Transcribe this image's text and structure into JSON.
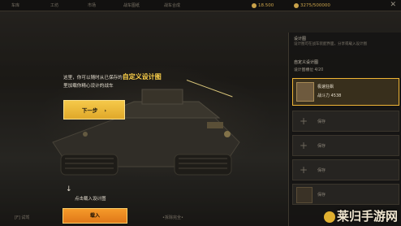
{
  "topbar": {
    "tabs": [
      "车库",
      "工坊",
      "市场",
      "战车图纸",
      "战车合成"
    ],
    "currency_a": "18.500",
    "currency_b": "3275/500000",
    "close": "✕"
  },
  "tutorial": {
    "line1_prefix": "这里，你可以随时从已保存的",
    "line1_highlight": "自定义设计图",
    "line2": "里加载你精心设计的战车",
    "next_label": "下一步",
    "next_chevron": "›"
  },
  "bottom": {
    "hint": "点击载入设计图",
    "hint_arrow": "↓",
    "load_label": "载入",
    "left_text": "[F] 试驾",
    "mid_text": "•拆除完全•"
  },
  "panel": {
    "title": "设计图",
    "subtitle": "设计图可在战车装配界面，分享或载入设计图",
    "tab": "自定义设计图",
    "capacity": "设计图槽位 4/20",
    "slots": [
      {
        "name": "极速狂飙",
        "power": "战斗力 4538",
        "active": true
      },
      {
        "label": "保存",
        "active": false
      },
      {
        "label": "保存",
        "active": false
      },
      {
        "label": "保存",
        "active": false
      },
      {
        "label": "保存",
        "active": false
      }
    ]
  },
  "watermark": "莱归手游网",
  "colors": {
    "accent": "#f0b535",
    "next_button": "#e0a82a",
    "load_button": "#e07818"
  }
}
